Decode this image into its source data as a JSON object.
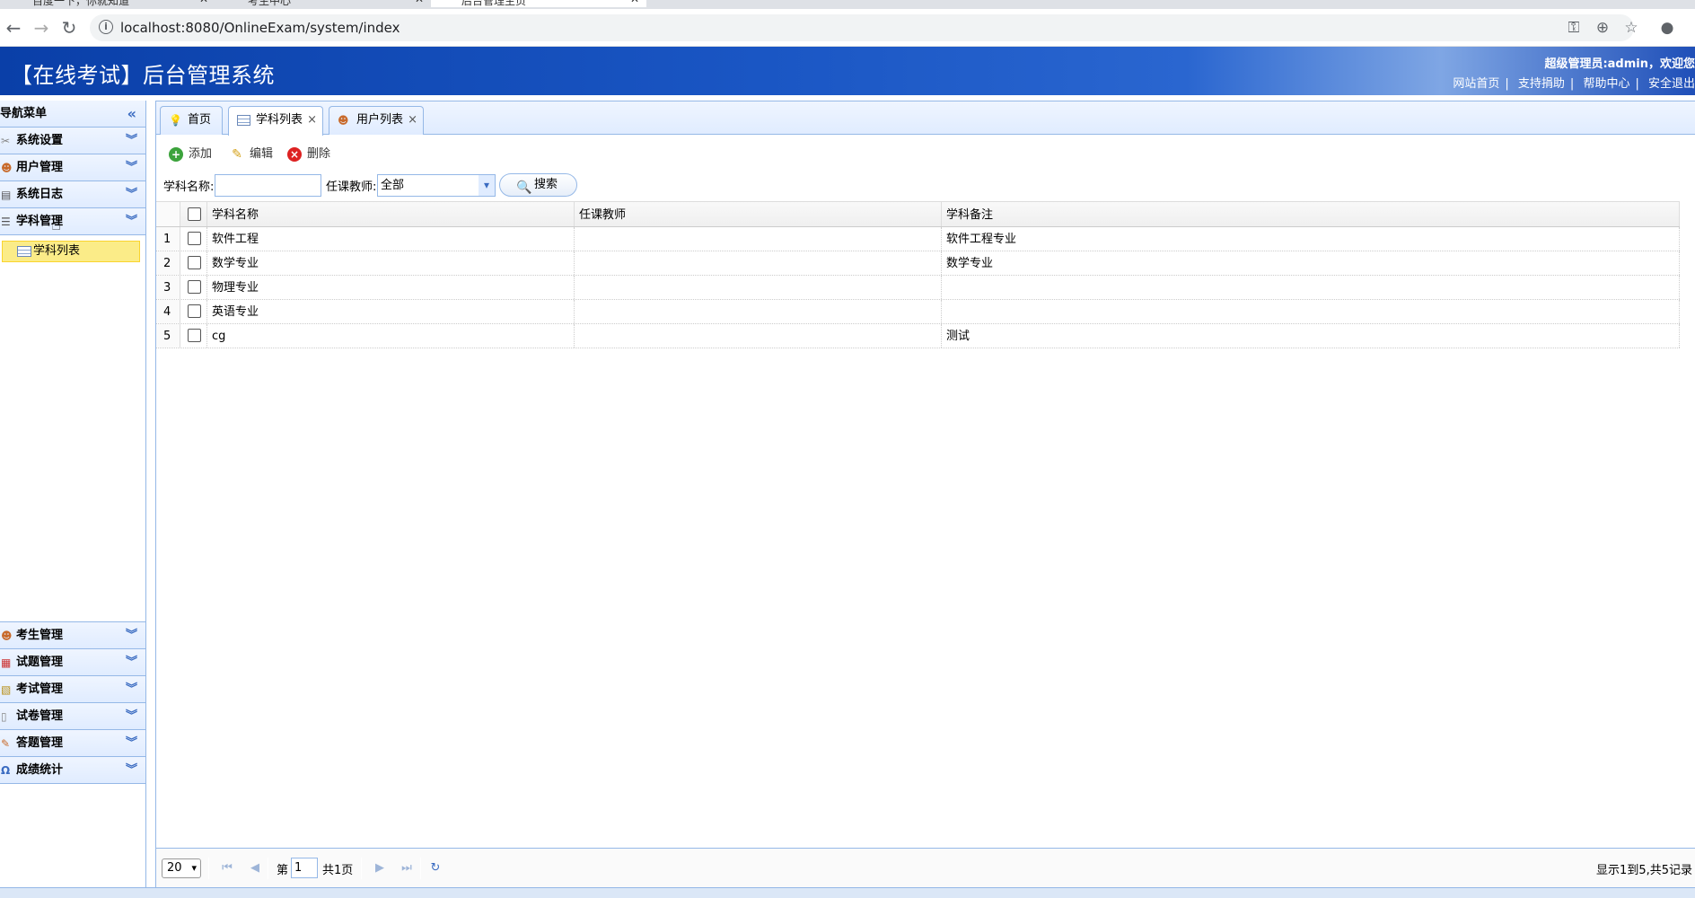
{
  "browser": {
    "tabs": [
      {
        "label": "百度一下，你就知道",
        "active": false
      },
      {
        "label": "考生中心",
        "active": false
      },
      {
        "label": "后台管理主页",
        "active": true
      }
    ],
    "url": "localhost:8080/OnlineExam/system/index"
  },
  "header": {
    "title": "【在线考试】后台管理系统",
    "welcome": "超级管理员:admin，欢迎您",
    "links": [
      "网站首页",
      "支持捐助",
      "帮助中心",
      "安全退出"
    ]
  },
  "nav": {
    "title": "导航菜单",
    "top_sections": [
      {
        "label": "系统设置",
        "icon": "tools-icon"
      },
      {
        "label": "用户管理",
        "icon": "users-icon"
      },
      {
        "label": "系统日志",
        "icon": "log-icon"
      },
      {
        "label": "学科管理",
        "icon": "list-icon"
      }
    ],
    "active_item": "学科列表",
    "bottom_sections": [
      {
        "label": "考生管理",
        "icon": "students-icon"
      },
      {
        "label": "试题管理",
        "icon": "calendar-icon"
      },
      {
        "label": "考试管理",
        "icon": "exam-icon"
      },
      {
        "label": "试卷管理",
        "icon": "paper-icon"
      },
      {
        "label": "答题管理",
        "icon": "answer-icon"
      },
      {
        "label": "成绩统计",
        "icon": "stats-icon"
      }
    ]
  },
  "tabs": [
    {
      "label": "首页",
      "closable": false,
      "active": false
    },
    {
      "label": "学科列表",
      "closable": true,
      "active": true
    },
    {
      "label": "用户列表",
      "closable": true,
      "active": false
    }
  ],
  "toolbar": {
    "add": "添加",
    "edit": "编辑",
    "delete": "删除"
  },
  "search": {
    "name_label": "学科名称:",
    "name_value": "",
    "teacher_label": "任课教师:",
    "teacher_value": "全部",
    "button": "搜索"
  },
  "grid": {
    "columns": [
      "学科名称",
      "任课教师",
      "学科备注"
    ],
    "rows": [
      {
        "num": "1",
        "name": "软件工程",
        "teacher": "",
        "note": "软件工程专业"
      },
      {
        "num": "2",
        "name": "数学专业",
        "teacher": "",
        "note": "数学专业"
      },
      {
        "num": "3",
        "name": "物理专业",
        "teacher": "",
        "note": ""
      },
      {
        "num": "4",
        "name": "英语专业",
        "teacher": "",
        "note": ""
      },
      {
        "num": "5",
        "name": "cg",
        "teacher": "",
        "note": "测试"
      }
    ]
  },
  "pager": {
    "page_size": "20",
    "page_prefix": "第",
    "page": "1",
    "page_total": "共1页",
    "info": "显示1到5,共5记录"
  },
  "colors": {
    "header_blue": "#1a56c4",
    "border_blue": "#95b8e7",
    "active_yellow": "#fbec88"
  }
}
